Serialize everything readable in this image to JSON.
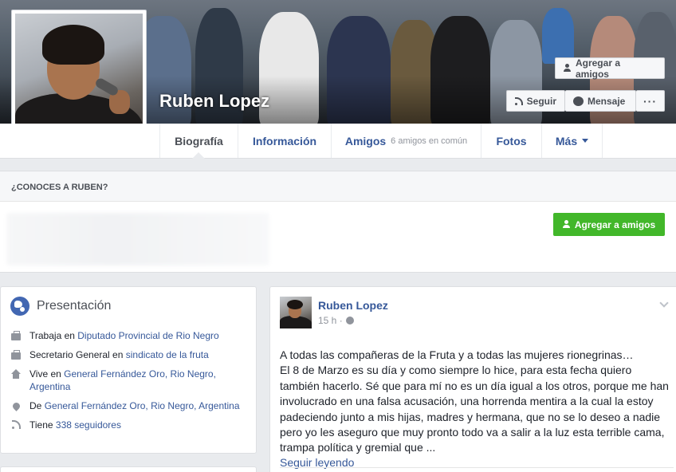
{
  "profile": {
    "name": "Ruben Lopez",
    "add_friend_label": "Agregar a amigos",
    "follow_label": "Seguir",
    "message_label": "Mensaje",
    "more_label": "···"
  },
  "tabs": {
    "biography": "Biografía",
    "info": "Información",
    "friends": "Amigos",
    "friends_sub": "6 amigos en común",
    "photos": "Fotos",
    "more": "Más"
  },
  "know": {
    "header": "¿CONOCES A RUBEN?",
    "add_friend_label": "Agregar a amigos"
  },
  "intro": {
    "title": "Presentación",
    "rows": [
      {
        "icon": "briefcase-icon",
        "prefix": "Trabaja en ",
        "link": "Diputado Provincial de Rio Negro"
      },
      {
        "icon": "briefcase-icon",
        "prefix": "Secretario General en ",
        "link": "sindicato de la fruta"
      },
      {
        "icon": "home-icon",
        "prefix": "Vive en ",
        "link": "General Fernández Oro, Rio Negro, Argentina"
      },
      {
        "icon": "location-pin-icon",
        "prefix": "De ",
        "link": "General Fernández Oro, Rio Negro, Argentina"
      },
      {
        "icon": "followers-icon",
        "prefix": "Tiene ",
        "link": "338 seguidores"
      }
    ]
  },
  "post": {
    "author": "Ruben Lopez",
    "time": "15 h ·",
    "text": "A todas las compañeras de la Fruta y a todas las mujeres rionegrinas…\nEl 8 de Marzo es su día y como siempre lo hice, para esta fecha quiero también hacerlo. Sé que para mí no es un día igual a los otros, porque me han involucrado en una falsa acusación, una horrenda mentira a la cual la estoy padeciendo junto a mis hijas, madres y hermana, que no se lo deseo a nadie pero yo les aseguro que muy pronto todo va a salir a la luz esta terrible cama, trampa política y gremial que ...",
    "read_more": "Seguir leyendo"
  },
  "colors": {
    "link": "#365899",
    "green_button": "#42b72a",
    "page_bg": "#e9ebee"
  }
}
